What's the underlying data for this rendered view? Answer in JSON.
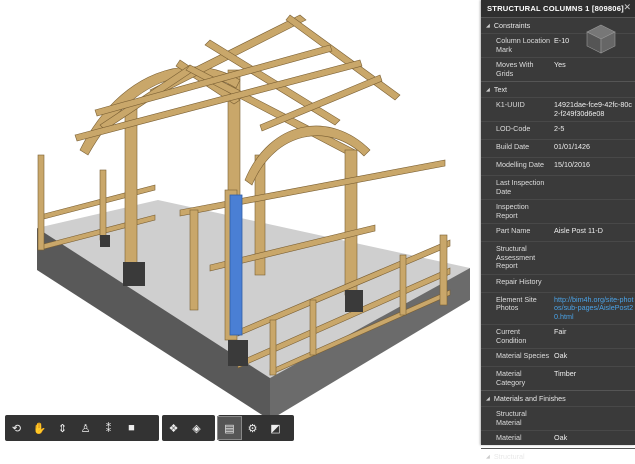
{
  "panel": {
    "title": "STRUCTURAL COLUMNS 1 [809806]",
    "sections": {
      "constraints": "Constraints",
      "text": "Text",
      "materials": "Materials and Finishes",
      "structural": "Structural"
    },
    "constraints": [
      {
        "key": "Column Location Mark",
        "value": "E-10"
      },
      {
        "key": "Moves With Grids",
        "value": "Yes"
      }
    ],
    "text": [
      {
        "key": "K1-UUID",
        "value": "14921dae-fce9-42fc-80c2-f249f30d6e08"
      },
      {
        "key": "LOD-Code",
        "value": "2-5"
      },
      {
        "key": "Build Date",
        "value": "01/01/1426"
      },
      {
        "key": "Modelling Date",
        "value": "15/10/2016"
      },
      {
        "key": "Last Inspection Date",
        "value": ""
      },
      {
        "key": "Inspection Report",
        "value": ""
      },
      {
        "key": "Part Name",
        "value": "Aisle Post 11-D"
      },
      {
        "key": "Structural Assessment Report",
        "value": ""
      },
      {
        "key": "Repair History",
        "value": ""
      },
      {
        "key": "Element Site Photos",
        "value": "http://bim4h.org/site-photos/sub-pages/AislePost20.html"
      },
      {
        "key": "Current Condition",
        "value": "Fair"
      },
      {
        "key": "Material Species",
        "value": "Oak"
      },
      {
        "key": "Material Category",
        "value": "Timber"
      }
    ],
    "materials": [
      {
        "key": "Structural Material",
        "value": ""
      },
      {
        "key": "Material",
        "value": "Oak"
      }
    ]
  },
  "toolbar": {
    "groups": [
      [
        "orbit-icon",
        "pan-icon",
        "zoom-icon",
        "person-icon",
        "walk-icon",
        "camera-icon"
      ],
      [
        "explode-icon",
        "model-browser-icon"
      ],
      [
        "properties-icon",
        "settings-icon",
        "fullscreen-icon"
      ]
    ]
  },
  "colors": {
    "timber": "#c9a76a",
    "timber_dark": "#a8874f",
    "selected": "#4a7fd4",
    "floor": "#c8c8c8",
    "base": "#555555",
    "panel_bg": "#3a3a3a",
    "link": "#4aa3e8"
  }
}
